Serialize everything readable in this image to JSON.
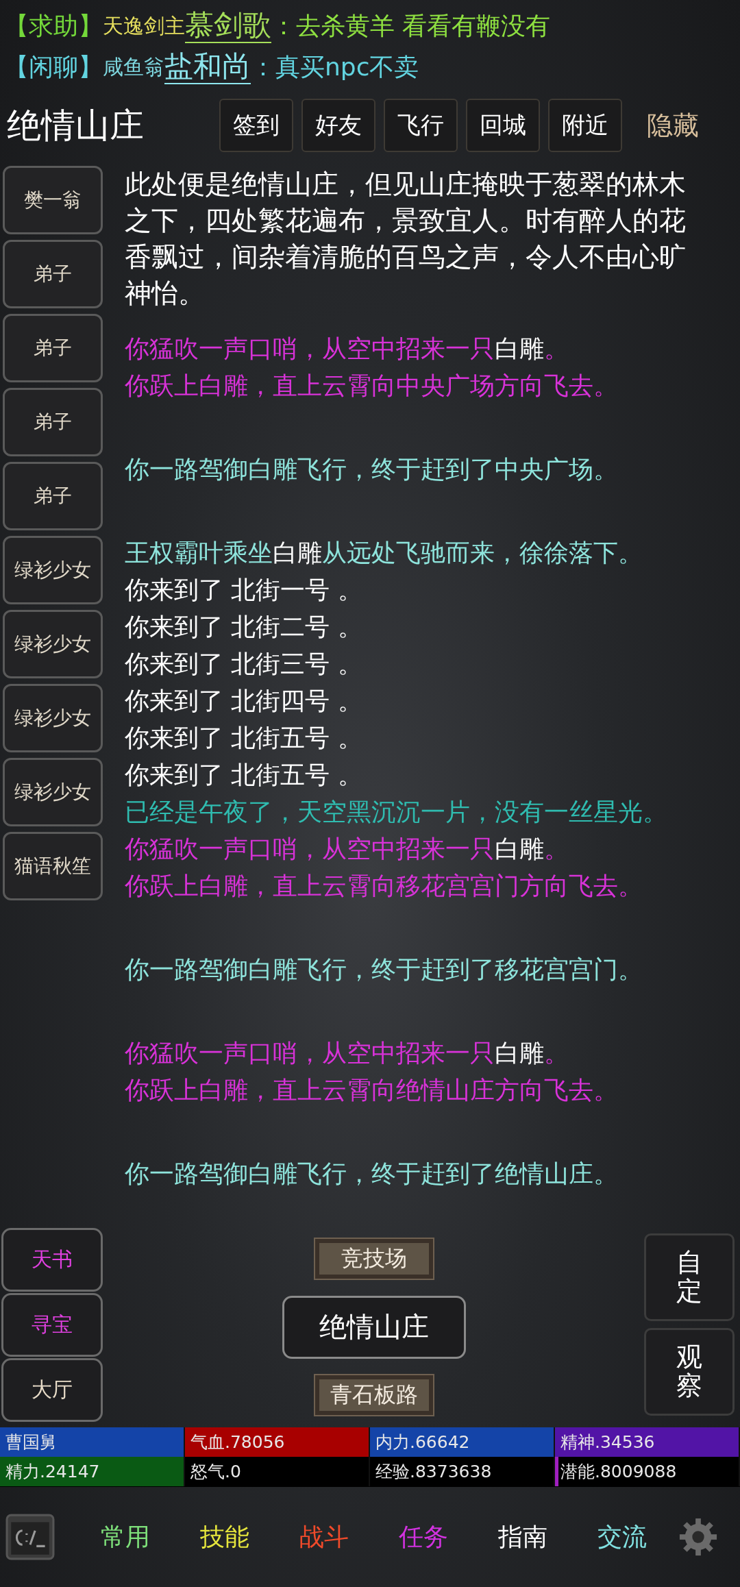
{
  "chat": [
    {
      "parts": [
        {
          "kind": "channel",
          "text": "【求助】",
          "color": "#74d83a"
        },
        {
          "kind": "title",
          "text": "天逸剑主",
          "color": "#e6df5e"
        },
        {
          "kind": "name",
          "text": "慕剑歌",
          "color": "#a6e05a"
        },
        {
          "kind": "message",
          "text": "：去杀黄羊 看看有鞭没有",
          "color": "#8ee040"
        }
      ]
    },
    {
      "parts": [
        {
          "kind": "channel",
          "text": "【闲聊】",
          "color": "#62d4e0"
        },
        {
          "kind": "title",
          "text": "咸鱼翁",
          "color": "#7ed8e0"
        },
        {
          "kind": "name",
          "text": "盐和尚",
          "color": "#8ee6ee"
        },
        {
          "kind": "message",
          "text": "：真买npc不卖",
          "color": "#62d4e0"
        }
      ]
    }
  ],
  "location": {
    "title": "绝情山庄"
  },
  "top_buttons": [
    "签到",
    "好友",
    "飞行",
    "回城",
    "附近"
  ],
  "hide_button": "隐藏",
  "npcs": [
    "樊一翁",
    "弟子",
    "弟子",
    "弟子",
    "弟子",
    "绿衫少女",
    "绿衫少女",
    "绿衫少女",
    "绿衫少女",
    "猫语秋笙"
  ],
  "description": "此处便是绝情山庄，但见山庄掩映于葱翠的林木之下，四处繁花遍布，景致宜人。时有醉人的花香飘过，间杂着清脆的百鸟之声，令人不由心旷神怡。",
  "log": [
    {
      "kind": "text",
      "segments": [
        {
          "text": "你猛吹一声口哨，从空中招来一只",
          "color": "#d832d8"
        },
        {
          "text": "白雕",
          "color": "#ffffff"
        },
        {
          "text": "。",
          "color": "#d832d8"
        }
      ]
    },
    {
      "kind": "text",
      "segments": [
        {
          "text": "你跃上白雕，直上云霄向中央广场方向飞去。",
          "color": "#d832d8"
        }
      ]
    },
    {
      "kind": "spacer"
    },
    {
      "kind": "text",
      "segments": [
        {
          "text": "你一路驾御白雕飞行，终于赶到了中央广场。",
          "color": "#8ee4dc"
        }
      ]
    },
    {
      "kind": "spacer"
    },
    {
      "kind": "text",
      "segments": [
        {
          "text": "王权霸叶乘坐",
          "color": "#8ee4dc"
        },
        {
          "text": "白雕",
          "color": "#ffffff"
        },
        {
          "text": "从远处飞驰而来，徐徐落下。",
          "color": "#8ee4dc"
        }
      ]
    },
    {
      "kind": "text",
      "segments": [
        {
          "text": "你来到了 北街一号 。",
          "color": "#ffffff"
        }
      ]
    },
    {
      "kind": "text",
      "segments": [
        {
          "text": "你来到了 北街二号 。",
          "color": "#ffffff"
        }
      ]
    },
    {
      "kind": "text",
      "segments": [
        {
          "text": "你来到了 北街三号 。",
          "color": "#ffffff"
        }
      ]
    },
    {
      "kind": "text",
      "segments": [
        {
          "text": "你来到了 北街四号 。",
          "color": "#ffffff"
        }
      ]
    },
    {
      "kind": "text",
      "segments": [
        {
          "text": "你来到了 北街五号 。",
          "color": "#ffffff"
        }
      ]
    },
    {
      "kind": "text",
      "segments": [
        {
          "text": "你来到了 北街五号 。",
          "color": "#ffffff"
        }
      ]
    },
    {
      "kind": "text",
      "segments": [
        {
          "text": "已经是午夜了，天空黑沉沉一片，没有一丝星光。",
          "color": "#2fbcb0"
        }
      ]
    },
    {
      "kind": "text",
      "segments": [
        {
          "text": "你猛吹一声口哨，从空中招来一只",
          "color": "#d832d8"
        },
        {
          "text": "白雕",
          "color": "#ffffff"
        },
        {
          "text": "。",
          "color": "#d832d8"
        }
      ]
    },
    {
      "kind": "text",
      "segments": [
        {
          "text": "你跃上白雕，直上云霄向移花宫宫门方向飞去。",
          "color": "#d832d8"
        }
      ]
    },
    {
      "kind": "spacer"
    },
    {
      "kind": "text",
      "segments": [
        {
          "text": "你一路驾御白雕飞行，终于赶到了移花宫宫门。",
          "color": "#8ee4dc"
        }
      ]
    },
    {
      "kind": "spacer"
    },
    {
      "kind": "text",
      "segments": [
        {
          "text": "你猛吹一声口哨，从空中招来一只",
          "color": "#d832d8"
        },
        {
          "text": "白雕",
          "color": "#ffffff"
        },
        {
          "text": "。",
          "color": "#d832d8"
        }
      ]
    },
    {
      "kind": "text",
      "segments": [
        {
          "text": "你跃上白雕，直上云霄向绝情山庄方向飞去。",
          "color": "#d832d8"
        }
      ]
    },
    {
      "kind": "spacer"
    },
    {
      "kind": "text",
      "segments": [
        {
          "text": "你一路驾御白雕飞行，终于赶到了绝情山庄。",
          "color": "#8ee4dc"
        }
      ]
    }
  ],
  "side_buttons": [
    {
      "label": "天书",
      "color": "#e040e0"
    },
    {
      "label": "寻宝",
      "color": "#e040e0"
    },
    {
      "label": "大厅",
      "color": "#e8dcc8"
    }
  ],
  "exits": {
    "north": "竞技场",
    "current": "绝情山庄",
    "south": "青石板路"
  },
  "right_buttons": [
    "自定",
    "观察"
  ],
  "stats": [
    {
      "label": "曹国舅",
      "level": 1,
      "color": "#1444a8"
    },
    {
      "label": "气血.78056",
      "level": 1,
      "color": "#a80000"
    },
    {
      "label": "内力.66642",
      "level": 1,
      "color": "#1444a8"
    },
    {
      "label": "精神.34536",
      "level": 1,
      "color": "#5214a6"
    },
    {
      "label": "精力.24147",
      "level": 1,
      "color": "#0a5a14"
    },
    {
      "label": "怒气.0"
    },
    {
      "label": "经验.8373638"
    },
    {
      "label": "潜能.8009088",
      "level": 0.02,
      "color": "#a020c0"
    }
  ],
  "nav": [
    {
      "label": "常用",
      "color": "#7ee07a"
    },
    {
      "label": "技能",
      "color": "#e6e63c"
    },
    {
      "label": "战斗",
      "color": "#f04a2a"
    },
    {
      "label": "任务",
      "color": "#d232e0"
    },
    {
      "label": "指南",
      "color": "#ffffff"
    },
    {
      "label": "交流",
      "color": "#82e2e2"
    }
  ]
}
